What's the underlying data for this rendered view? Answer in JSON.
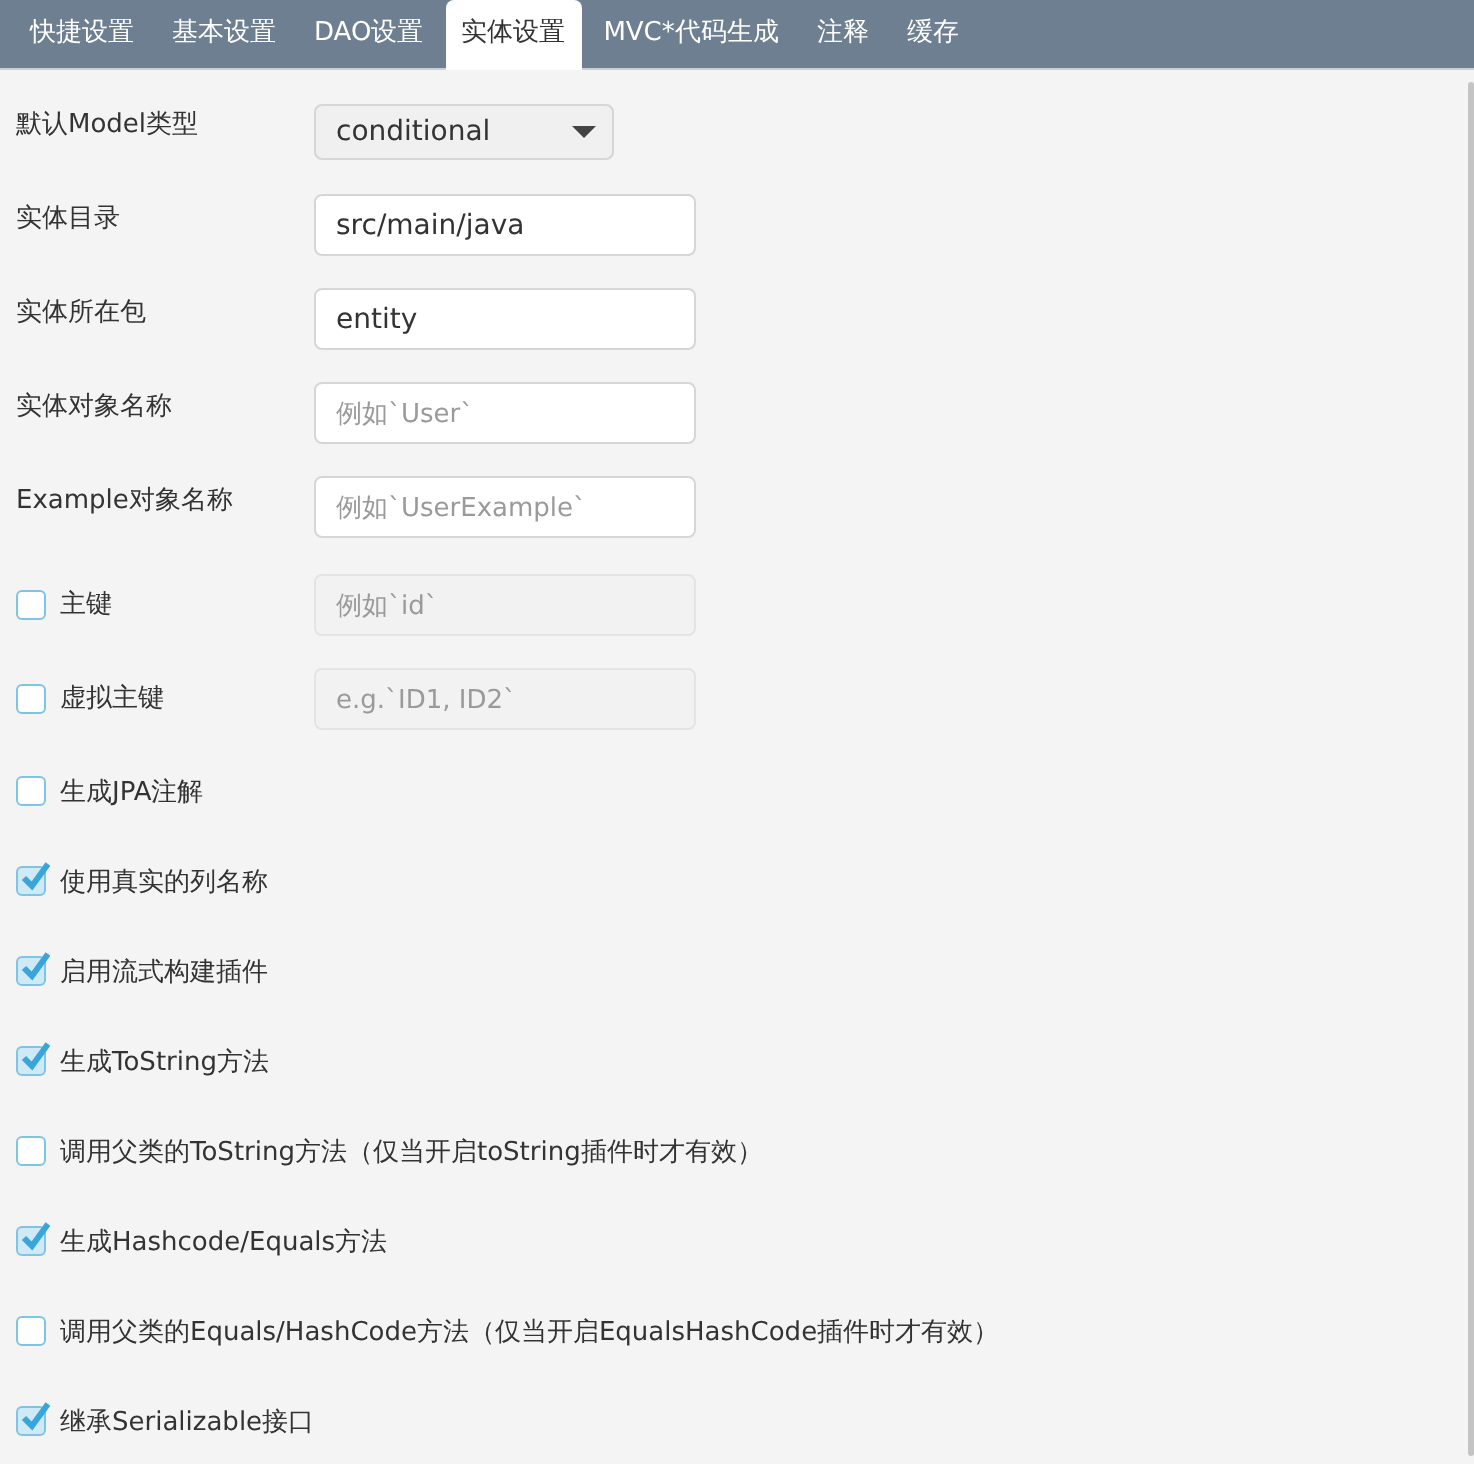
{
  "tabs": [
    {
      "label": "快捷设置",
      "selected": false
    },
    {
      "label": "基本设置",
      "selected": false
    },
    {
      "label": "DAO设置",
      "selected": false
    },
    {
      "label": "实体设置",
      "selected": true
    },
    {
      "label": "MVC*代码生成",
      "selected": false
    },
    {
      "label": "注释",
      "selected": false
    },
    {
      "label": "缓存",
      "selected": false
    }
  ],
  "rows": [
    {
      "kind": "select",
      "label": "默认Model类型",
      "value": "conditional"
    },
    {
      "kind": "input",
      "label": "实体目录",
      "value": "src/main/java"
    },
    {
      "kind": "input",
      "label": "实体所在包",
      "value": "entity"
    },
    {
      "kind": "input",
      "label": "实体对象名称",
      "placeholder": "例如`User`"
    },
    {
      "kind": "input",
      "label": "Example对象名称",
      "placeholder": "例如`UserExample`"
    },
    {
      "kind": "checkbox_input",
      "label": "主键",
      "checked": false,
      "disabled": true,
      "placeholder": "例如`id`"
    },
    {
      "kind": "checkbox_input",
      "label": "虚拟主键",
      "checked": false,
      "disabled": true,
      "placeholder": "e.g.`ID1, ID2`"
    },
    {
      "kind": "checkbox",
      "label": "生成JPA注解",
      "checked": false
    },
    {
      "kind": "checkbox",
      "label": "使用真实的列名称",
      "checked": true
    },
    {
      "kind": "checkbox",
      "label": "启用流式构建插件",
      "checked": true
    },
    {
      "kind": "checkbox",
      "label": "生成ToString方法",
      "checked": true
    },
    {
      "kind": "checkbox",
      "label": "调用父类的ToString方法（仅当开启toString插件时才有效）",
      "checked": false
    },
    {
      "kind": "checkbox",
      "label": "生成Hashcode/Equals方法",
      "checked": true
    },
    {
      "kind": "checkbox",
      "label": "调用父类的Equals/HashCode方法（仅当开启EqualsHashCode插件时才有效）",
      "checked": false
    },
    {
      "kind": "checkbox",
      "label": "继承Serializable接口",
      "checked": true
    }
  ]
}
